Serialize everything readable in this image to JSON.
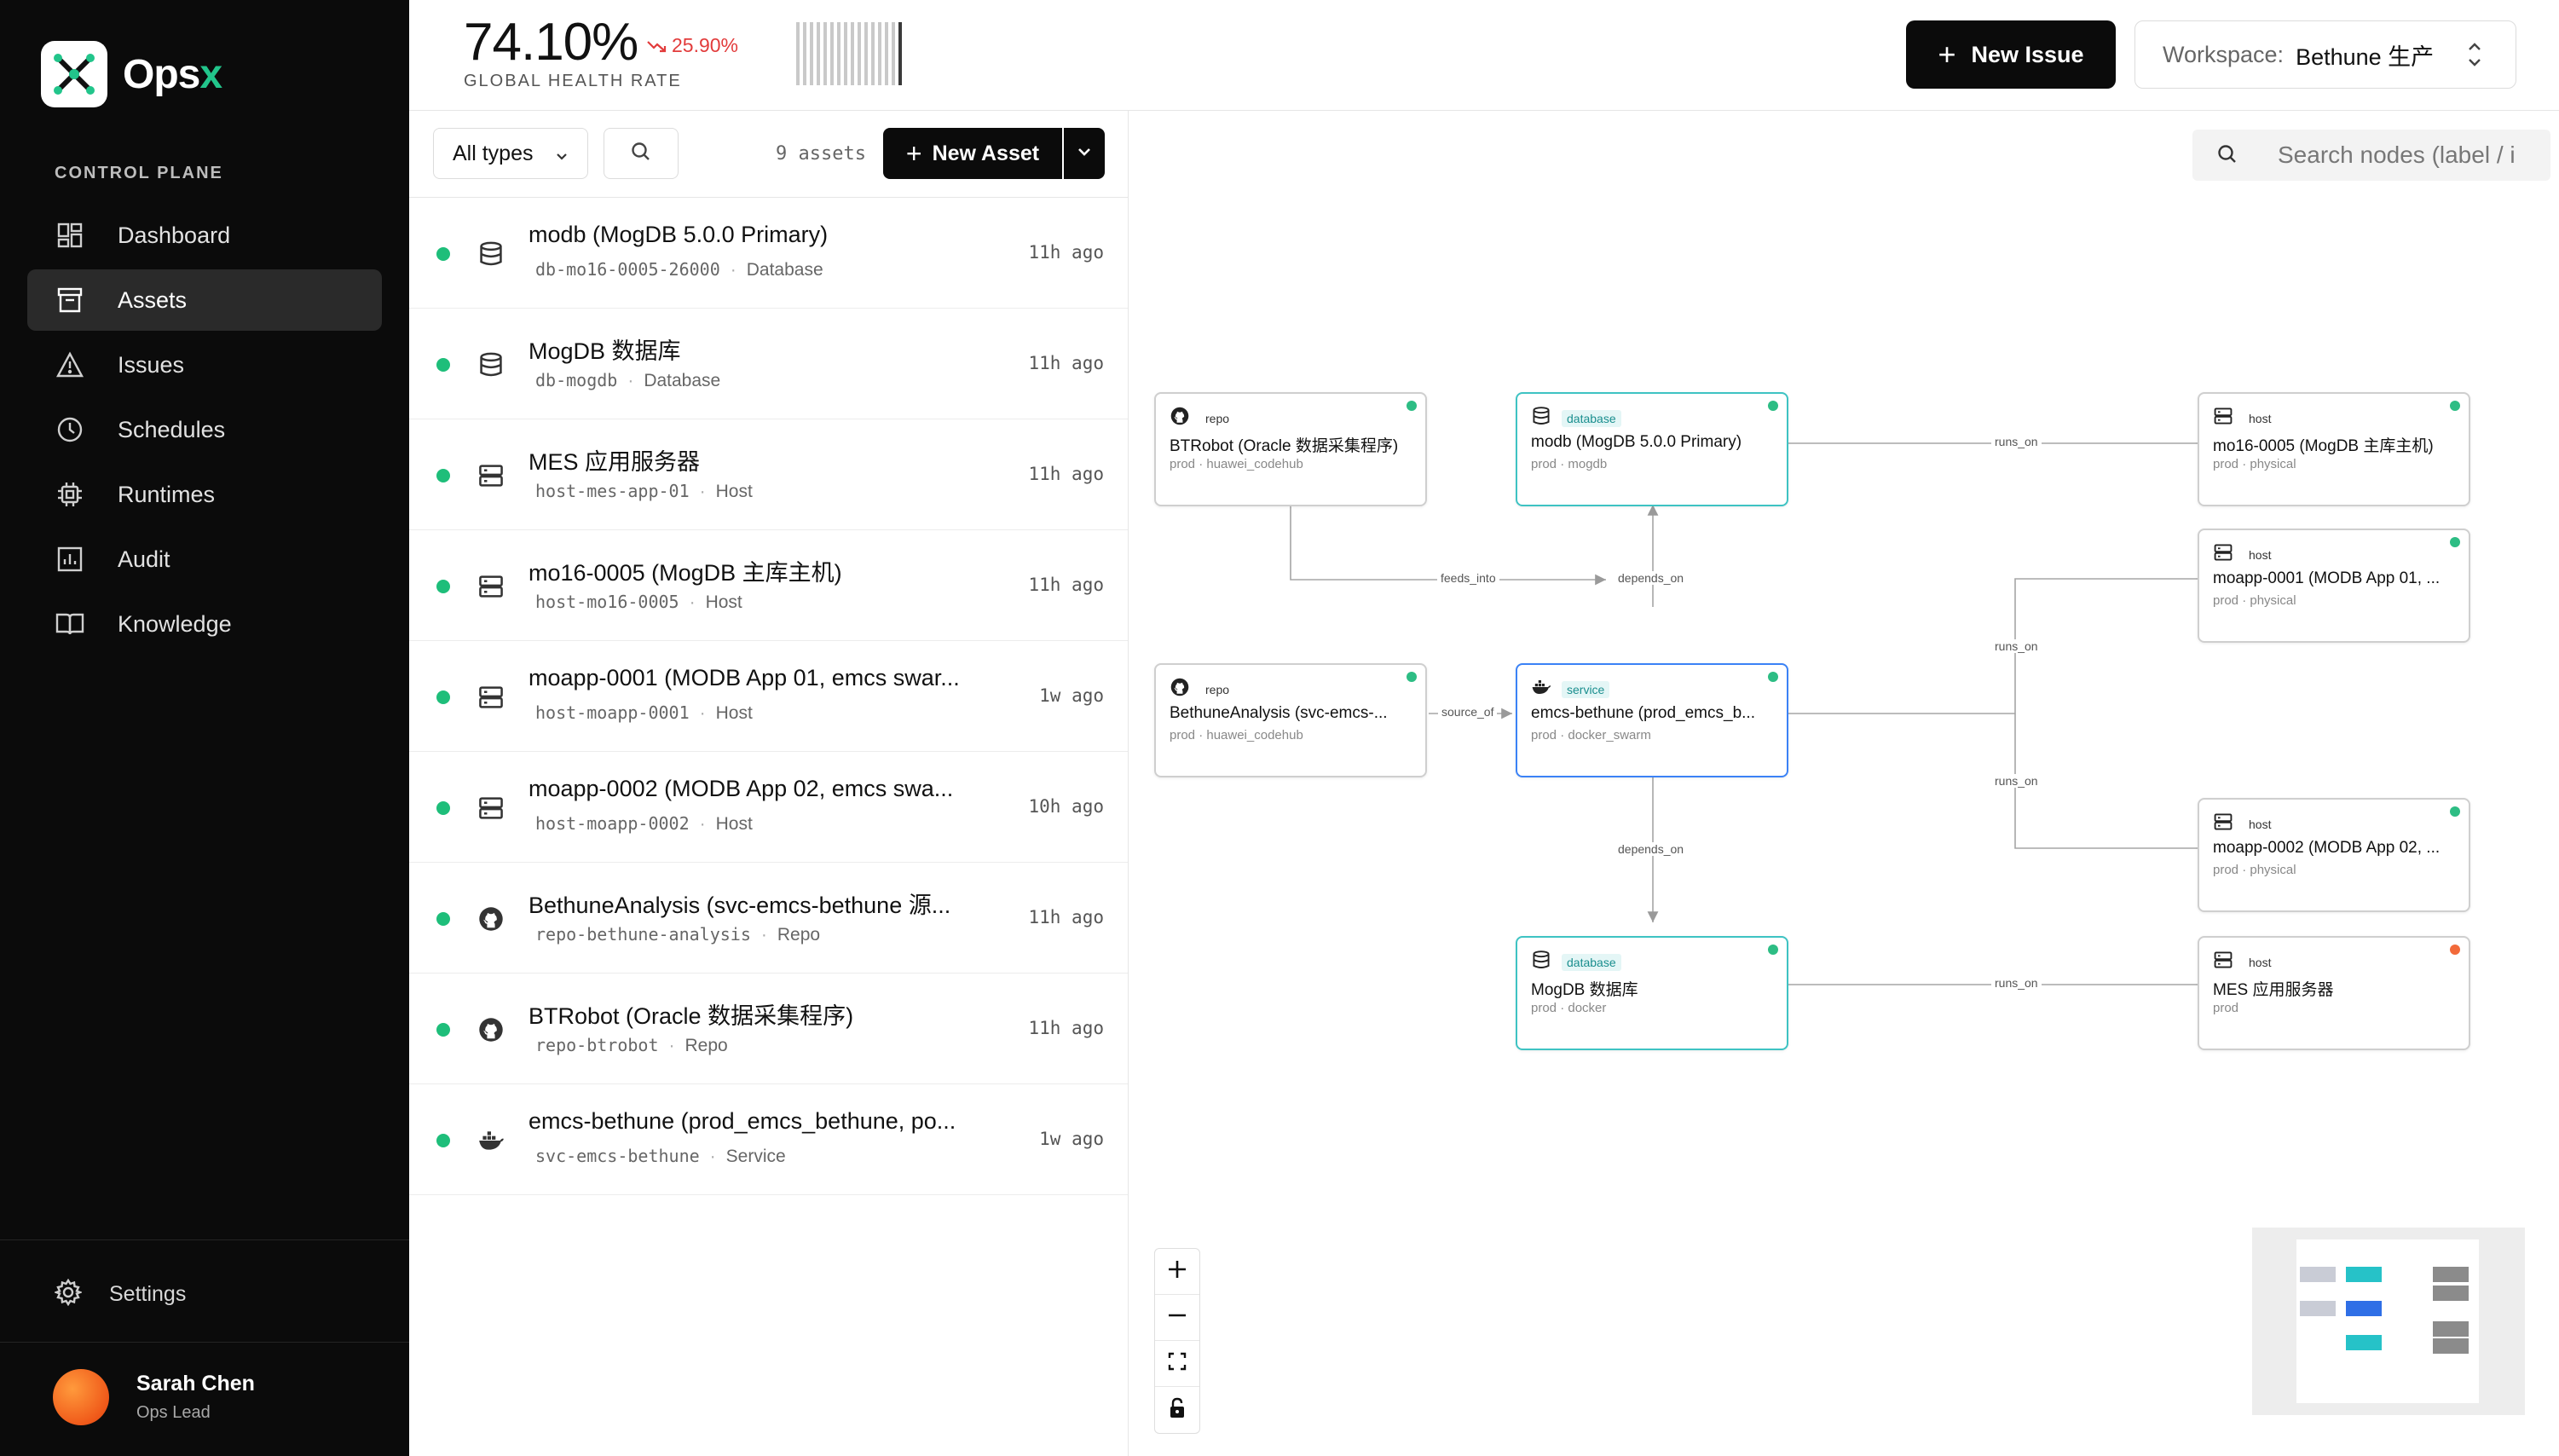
{
  "app": {
    "name_prefix": "Ops",
    "name_suffix": "x",
    "section_label": "CONTROL PLANE"
  },
  "nav": [
    {
      "label": "Dashboard",
      "icon": "dashboard-icon",
      "active": false
    },
    {
      "label": "Assets",
      "icon": "assets-icon",
      "active": true
    },
    {
      "label": "Issues",
      "icon": "warning-icon",
      "active": false
    },
    {
      "label": "Schedules",
      "icon": "clock-icon",
      "active": false
    },
    {
      "label": "Runtimes",
      "icon": "chip-icon",
      "active": false
    },
    {
      "label": "Audit",
      "icon": "audit-chart-icon",
      "active": false
    },
    {
      "label": "Knowledge",
      "icon": "book-icon",
      "active": false
    }
  ],
  "settings_label": "Settings",
  "user": {
    "name": "Sarah Chen",
    "role": "Ops Lead"
  },
  "header": {
    "health_value": "74.10%",
    "health_trend": "25.90%",
    "health_label": "GLOBAL HEALTH RATE",
    "health_fraction": 0.741,
    "new_issue_label": "New Issue",
    "workspace_label": "Workspace:",
    "workspace_value": "Bethune 生产"
  },
  "toolbar": {
    "type_filter": "All types",
    "asset_count": "9 assets",
    "new_asset_label": "New Asset"
  },
  "assets": [
    {
      "name": "modb (MogDB 5.0.0 Primary)",
      "slug": "db-mo16-0005-26000",
      "kind": "Database",
      "time": "11h ago",
      "icon": "database-icon"
    },
    {
      "name": "MogDB 数据库",
      "slug": "db-mogdb",
      "kind": "Database",
      "time": "11h ago",
      "icon": "database-icon"
    },
    {
      "name": "MES 应用服务器",
      "slug": "host-mes-app-01",
      "kind": "Host",
      "time": "11h ago",
      "icon": "server-icon"
    },
    {
      "name": "mo16-0005 (MogDB 主库主机)",
      "slug": "host-mo16-0005",
      "kind": "Host",
      "time": "11h ago",
      "icon": "server-icon"
    },
    {
      "name": "moapp-0001 (MODB App 01, emcs swar...",
      "slug": "host-moapp-0001",
      "kind": "Host",
      "time": "1w ago",
      "icon": "server-icon"
    },
    {
      "name": "moapp-0002 (MODB App 02, emcs swa...",
      "slug": "host-moapp-0002",
      "kind": "Host",
      "time": "10h ago",
      "icon": "server-icon"
    },
    {
      "name": "BethuneAnalysis (svc-emcs-bethune 源...",
      "slug": "repo-bethune-analysis",
      "kind": "Repo",
      "time": "11h ago",
      "icon": "github-icon"
    },
    {
      "name": "BTRobot (Oracle 数据采集程序)",
      "slug": "repo-btrobot",
      "kind": "Repo",
      "time": "11h ago",
      "icon": "github-icon"
    },
    {
      "name": "emcs-bethune (prod_emcs_bethune, po...",
      "slug": "svc-emcs-bethune",
      "kind": "Service",
      "time": "1w ago",
      "icon": "docker-icon"
    }
  ],
  "graph": {
    "search_placeholder": "Search nodes (label / i",
    "nodes": [
      {
        "type": "repo",
        "name": "BTRobot (Oracle 数据采集程序)",
        "meta": "prod · huawei_codehub",
        "icon": "github-icon"
      },
      {
        "type": "database",
        "name": "modb (MogDB 5.0.0 Primary)",
        "meta": "prod · mogdb",
        "icon": "database-icon"
      },
      {
        "type": "host",
        "name": "mo16-0005 (MogDB 主库主机)",
        "meta": "prod · physical",
        "icon": "server-icon"
      },
      {
        "type": "host",
        "name": "moapp-0001 (MODB App 01, ...",
        "meta": "prod · physical",
        "icon": "server-icon"
      },
      {
        "type": "repo",
        "name": "BethuneAnalysis (svc-emcs-...",
        "meta": "prod · huawei_codehub",
        "icon": "github-icon"
      },
      {
        "type": "service",
        "name": "emcs-bethune (prod_emcs_b...",
        "meta": "prod · docker_swarm",
        "icon": "docker-icon"
      },
      {
        "type": "host",
        "name": "moapp-0002 (MODB App 02, ...",
        "meta": "prod · physical",
        "icon": "server-icon"
      },
      {
        "type": "database",
        "name": "MogDB 数据库",
        "meta": "prod · docker",
        "icon": "database-icon"
      },
      {
        "type": "host",
        "name": "MES 应用服务器",
        "meta": "prod",
        "icon": "server-icon"
      }
    ],
    "edge_labels": [
      "runs_on",
      "feeds_into",
      "depends_on",
      "runs_on",
      "source_of",
      "runs_on",
      "depends_on",
      "runs_on"
    ]
  },
  "colors": {
    "accent": "#22c58b",
    "status_ok": "#1ebe7a",
    "status_warn": "#f26a3a",
    "trend_down": "#e23b3b",
    "teal": "#3ec3c3",
    "blue": "#3b82f6"
  }
}
